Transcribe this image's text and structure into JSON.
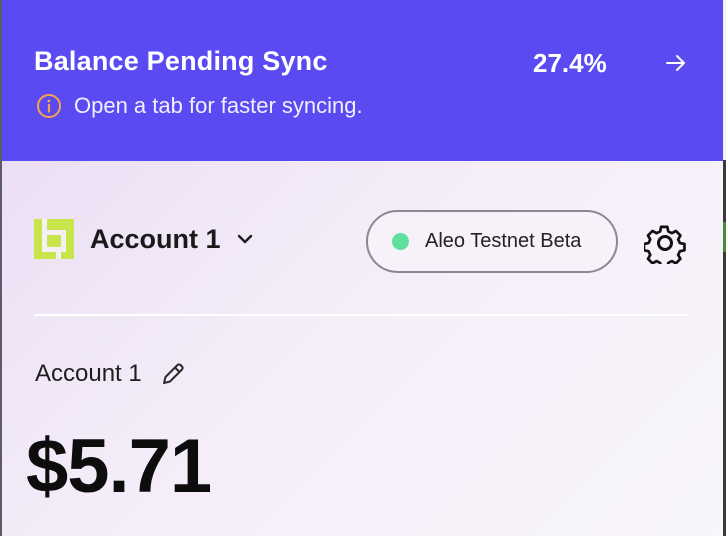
{
  "banner": {
    "title": "Balance Pending Sync",
    "percent": "27.4%",
    "message": "Open a tab for faster syncing.",
    "background_color": "#5a4af2",
    "info_icon_color": "#f5a44a",
    "arrow_icon": "arrow-right-icon"
  },
  "header": {
    "account_name": "Account 1",
    "account_chevron_icon": "chevron-down-icon",
    "logo_color": "#c8e64b",
    "network": {
      "label": "Aleo Testnet Beta",
      "status_color": "#5ee09e"
    },
    "settings_icon": "gear-icon"
  },
  "account": {
    "label": "Account 1",
    "edit_icon": "pencil-icon",
    "balance": "$5.71"
  }
}
